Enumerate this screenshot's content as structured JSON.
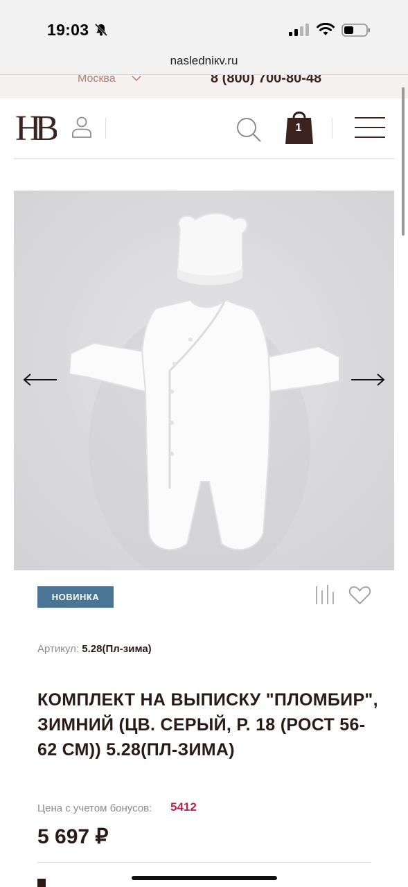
{
  "status_bar": {
    "time": "19:03"
  },
  "browser": {
    "url": "nasledniкv.ru"
  },
  "top_strip": {
    "city": "Москва",
    "phone": "8 (800) 700-80-48"
  },
  "header": {
    "logo": "HB",
    "cart_count": "1"
  },
  "gallery": {
    "image_alt": "white baby winter jumpsuit with bear-ear hat"
  },
  "product": {
    "badge": "НОВИНКА",
    "sku_label": "Артикул:",
    "sku_value": "5.28(Пл-зима)",
    "title": "КОМПЛЕКТ НА ВЫПИСКУ \"ПЛОМБИР\", ЗИМНИЙ (ЦВ. СЕРЫЙ, Р. 18 (РОСТ 56-62 СМ)) 5.28(ПЛ-ЗИМА)",
    "bonus_label": "Цена с учетом бонусов:",
    "bonus_value": "5412",
    "price": "5 697 ₽"
  },
  "colors": {
    "accent": "#4a7594",
    "bonus": "#b8244c",
    "brand": "#3b2420"
  }
}
